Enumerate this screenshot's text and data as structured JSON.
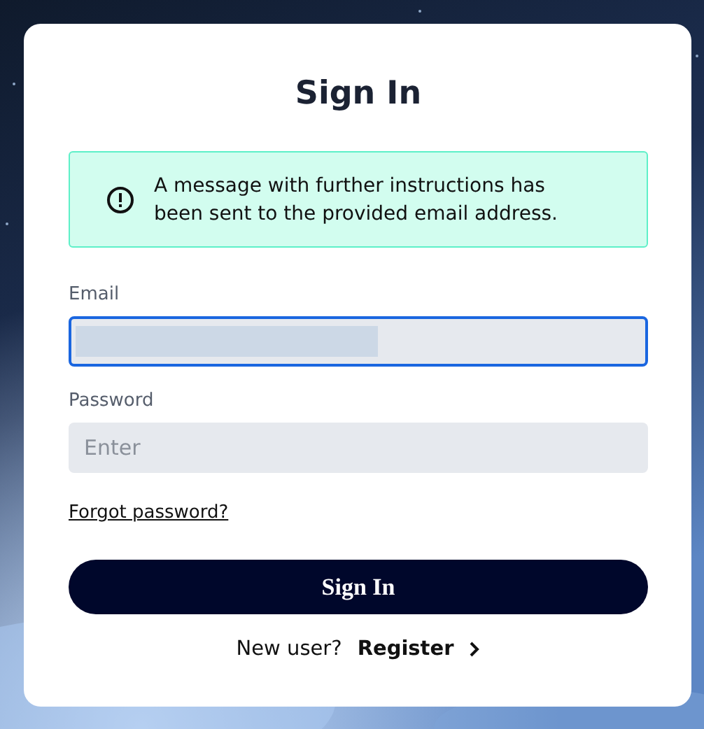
{
  "title": "Sign In",
  "alert": {
    "kind": "info",
    "message": "A message with further instructions has been sent to the provided email address."
  },
  "fields": [
    {
      "label": "Email",
      "focused": true,
      "redacted": true
    },
    {
      "label": "Password",
      "focused": false,
      "placeholder": "Enter"
    }
  ],
  "forgot_link": "Forgot password?",
  "submit_button": "Sign In",
  "footer": {
    "prompt": "New user?",
    "link": "Register"
  }
}
